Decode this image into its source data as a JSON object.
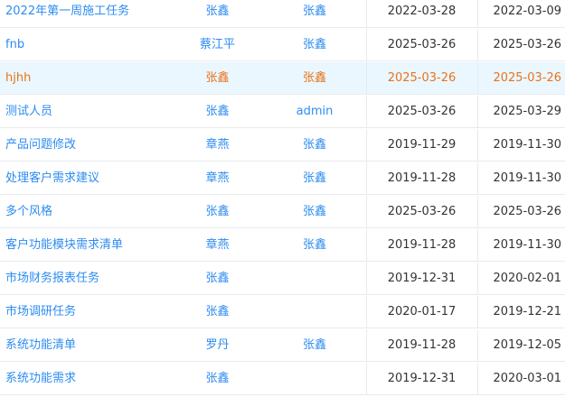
{
  "rows": [
    {
      "name": "2022年第一周施工任务",
      "owner": "张鑫",
      "assignee": "张鑫",
      "start": "2022-03-28",
      "end": "2022-03-09"
    },
    {
      "name": "fnb",
      "owner": "蔡江平",
      "assignee": "张鑫",
      "start": "2025-03-26",
      "end": "2025-03-26"
    },
    {
      "name": "hjhh",
      "owner": "张鑫",
      "assignee": "张鑫",
      "start": "2025-03-26",
      "end": "2025-03-26"
    },
    {
      "name": "测试人员",
      "owner": "张鑫",
      "assignee": "admin",
      "start": "2025-03-26",
      "end": "2025-03-29"
    },
    {
      "name": "产品问题修改",
      "owner": "章燕",
      "assignee": "张鑫",
      "start": "2019-11-29",
      "end": "2019-11-30"
    },
    {
      "name": "处理客户需求建议",
      "owner": "章燕",
      "assignee": "张鑫",
      "start": "2019-11-28",
      "end": "2019-11-30"
    },
    {
      "name": "多个风格",
      "owner": "张鑫",
      "assignee": "张鑫",
      "start": "2025-03-26",
      "end": "2025-03-26"
    },
    {
      "name": "客户功能模块需求清单",
      "owner": "章燕",
      "assignee": "张鑫",
      "start": "2019-11-28",
      "end": "2019-11-30"
    },
    {
      "name": "市场财务报表任务",
      "owner": "张鑫",
      "assignee": "",
      "start": "2019-12-31",
      "end": "2020-02-01"
    },
    {
      "name": "市场调研任务",
      "owner": "张鑫",
      "assignee": "",
      "start": "2020-01-17",
      "end": "2019-12-21"
    },
    {
      "name": "系统功能清单",
      "owner": "罗丹",
      "assignee": "张鑫",
      "start": "2019-11-28",
      "end": "2019-12-05"
    },
    {
      "name": "系统功能需求",
      "owner": "张鑫",
      "assignee": "",
      "start": "2019-12-31",
      "end": "2020-03-01"
    }
  ],
  "highlighted_row_index": 2,
  "colors": {
    "link": "#2d8cf0",
    "highlight_text": "#e8731b",
    "highlight_bg": "#ebf7ff",
    "border": "#e8eaec"
  }
}
